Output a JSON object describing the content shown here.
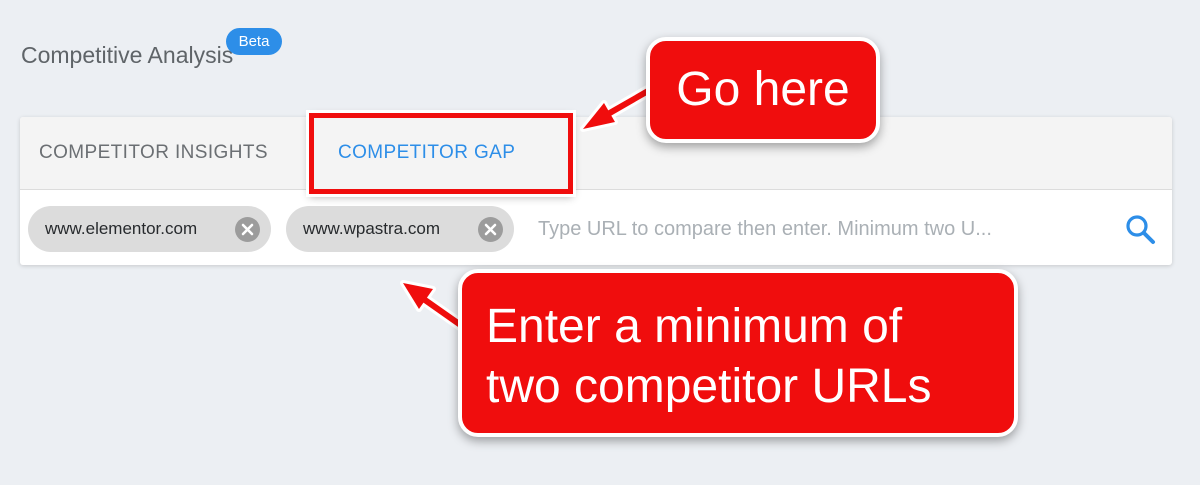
{
  "header": {
    "title": "Competitive Analysis",
    "badge": "Beta"
  },
  "tabs": [
    {
      "label": "COMPETITOR INSIGHTS",
      "active": false
    },
    {
      "label": "COMPETITOR GAP",
      "active": true
    }
  ],
  "url_field": {
    "chips": [
      {
        "label": "www.elementor.com"
      },
      {
        "label": "www.wpastra.com"
      }
    ],
    "placeholder": "Type URL to compare then enter. Minimum two U..."
  },
  "icons": {
    "chip_remove": "close-circle-icon",
    "search": "search-icon"
  },
  "annotations": {
    "go_here": "Go here",
    "enter_line_1": "Enter a minimum of",
    "enter_line_2": "two competitor URLs"
  },
  "colors": {
    "accent": "#2d8ee8",
    "annotation": "#f00d0d",
    "background": "#eceff3"
  }
}
